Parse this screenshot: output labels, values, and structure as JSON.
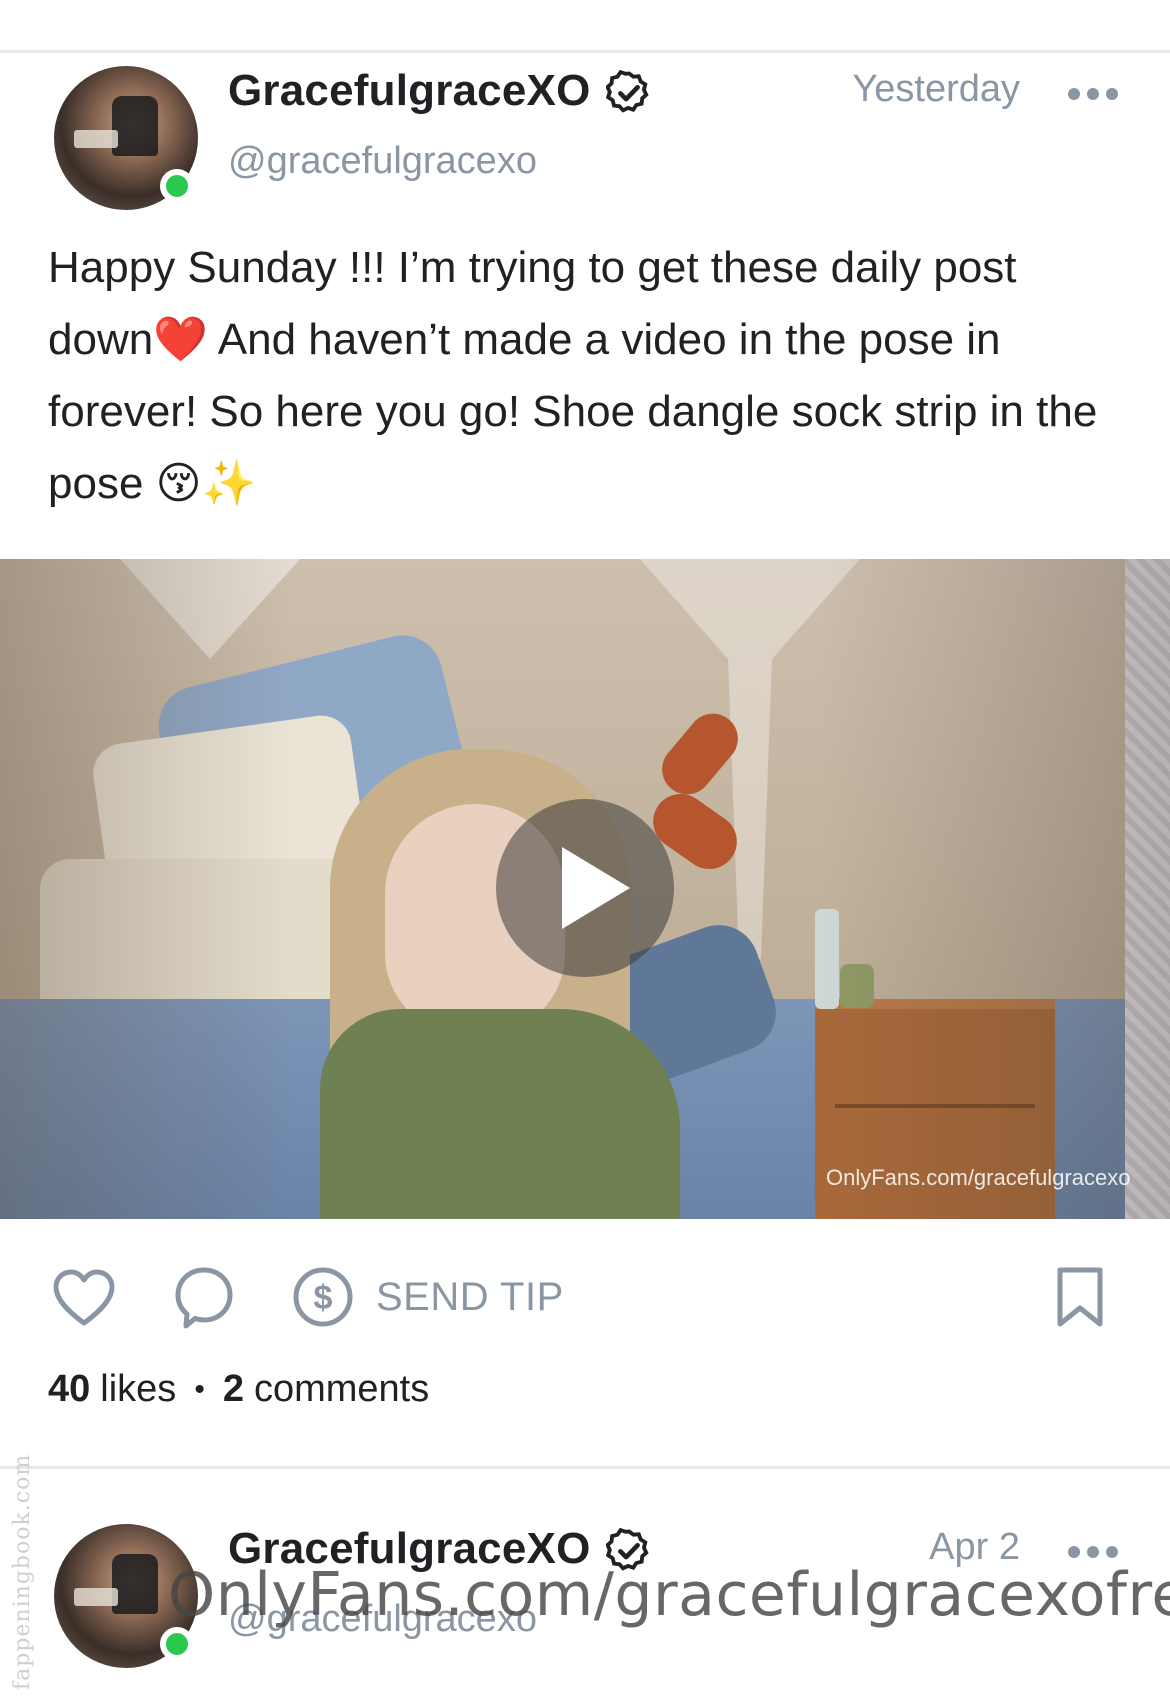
{
  "posts": [
    {
      "author": {
        "display_name": "GracefulgraceXO",
        "handle": "@gracefulgracexo",
        "online": true
      },
      "timestamp": "Yesterday",
      "caption": "Happy Sunday !!! I’m trying to get these daily post down❤️ And haven’t made a video in the pose in forever! So here you go! Shoe dangle sock strip in the pose 😚✨",
      "media": {
        "type": "video",
        "watermark": "OnlyFans.com/gracefulgracexo"
      },
      "actions": {
        "send_tip_label": "SEND TIP"
      },
      "stats": {
        "likes_count": "40",
        "likes_word": "likes",
        "comments_count": "2",
        "comments_word": "comments"
      }
    },
    {
      "author": {
        "display_name": "GracefulgraceXO",
        "handle": "@gracefulgracexo",
        "online": true
      },
      "timestamp": "Apr 2"
    }
  ],
  "overlays": {
    "side_watermark": "fappeningbook.com",
    "large_watermark": "OnlyFans.com/gracefulgracexofree"
  },
  "colors": {
    "muted": "#8a96a3",
    "online": "#2ac84f",
    "text": "#1f2124",
    "divider": "#e6e8eb"
  },
  "icons": [
    "verified-icon",
    "more-icon",
    "play-icon",
    "heart-icon",
    "comment-icon",
    "dollar-icon",
    "bookmark-icon"
  ]
}
